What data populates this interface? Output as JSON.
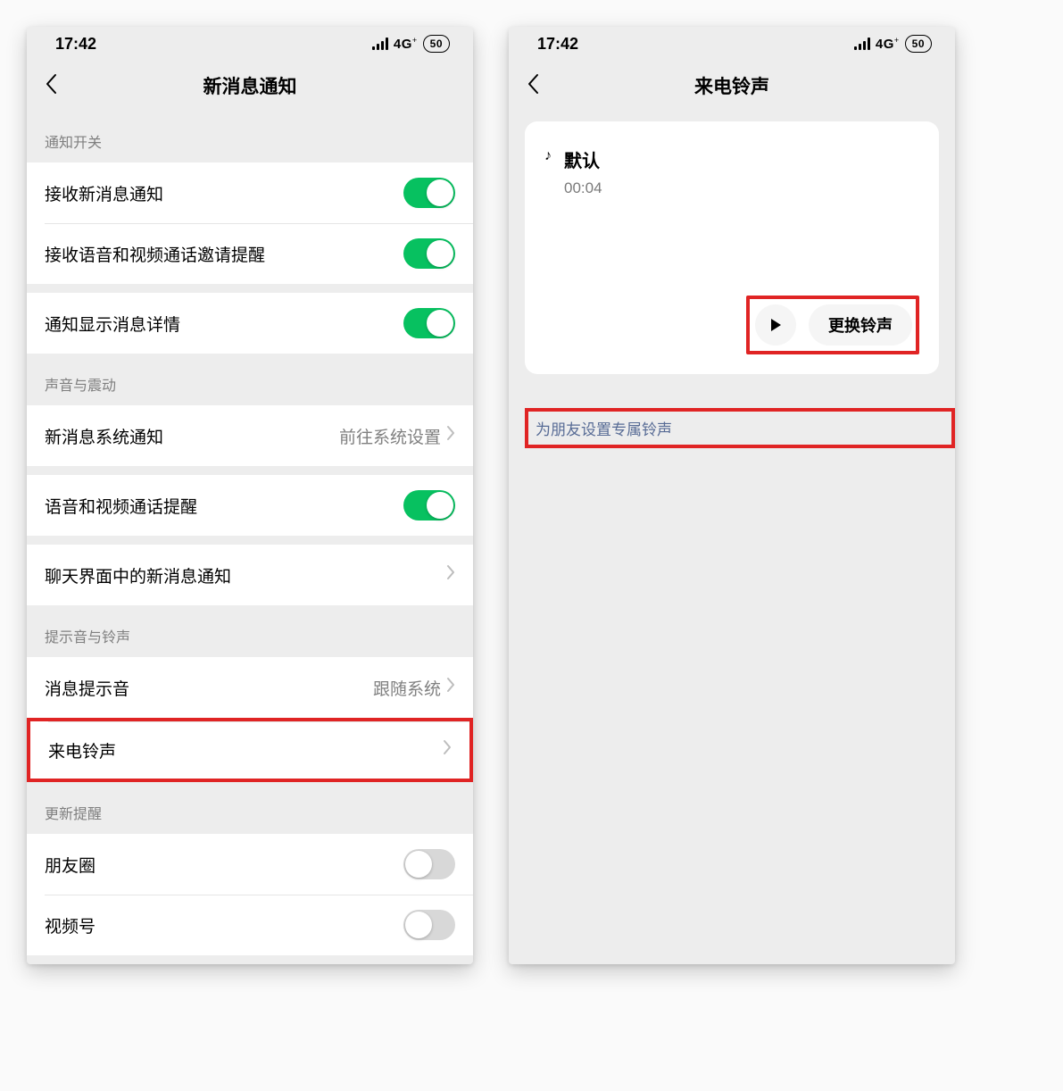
{
  "status": {
    "time": "17:42",
    "net": "4G",
    "net_sub": "+",
    "battery": "50"
  },
  "left": {
    "title": "新消息通知",
    "sections": [
      {
        "header": "通知开关",
        "cells": [
          {
            "label": "接收新消息通知",
            "type": "switch",
            "on": true
          },
          {
            "label": "接收语音和视频通话邀请提醒",
            "type": "switch",
            "on": true
          },
          {
            "gap": true
          },
          {
            "label": "通知显示消息详情",
            "type": "switch",
            "on": true
          }
        ]
      },
      {
        "header": "声音与震动",
        "cells": [
          {
            "label": "新消息系统通知",
            "type": "link",
            "value": "前往系统设置"
          },
          {
            "gap": true
          },
          {
            "label": "语音和视频通话提醒",
            "type": "switch",
            "on": true
          },
          {
            "gap": true
          },
          {
            "label": "聊天界面中的新消息通知",
            "type": "link"
          }
        ]
      },
      {
        "header": "提示音与铃声",
        "cells": [
          {
            "label": "消息提示音",
            "type": "link",
            "value": "跟随系统"
          },
          {
            "label": "来电铃声",
            "type": "link",
            "highlight": true
          }
        ]
      },
      {
        "header": "更新提醒",
        "cells": [
          {
            "label": "朋友圈",
            "type": "switch",
            "on": false
          },
          {
            "label": "视频号",
            "type": "switch",
            "on": false
          }
        ]
      }
    ]
  },
  "right": {
    "title": "来电铃声",
    "ringtone": {
      "name": "默认",
      "time": "00:04"
    },
    "change_btn": "更换铃声",
    "friend_link": "为朋友设置专属铃声"
  }
}
